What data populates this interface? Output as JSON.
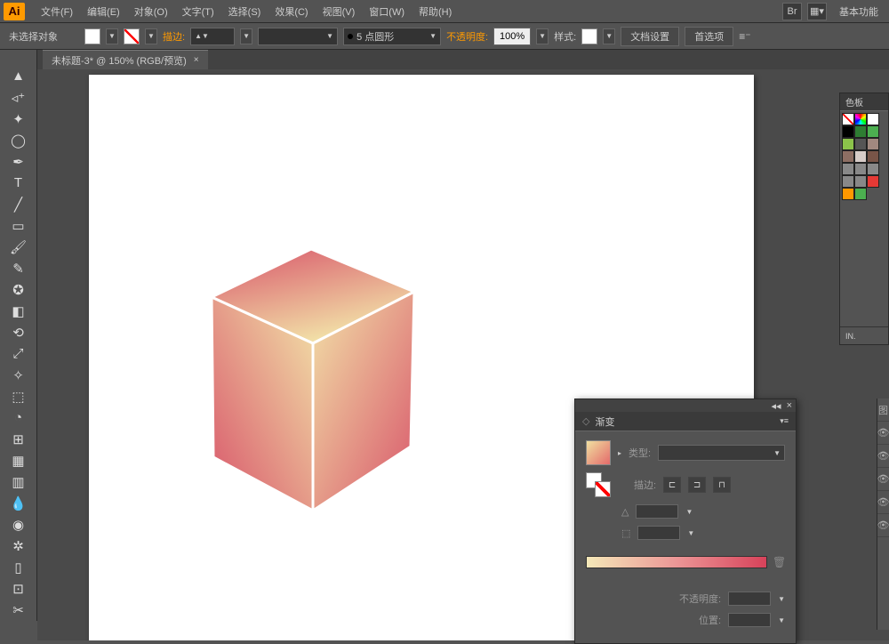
{
  "app": {
    "logo": "Ai"
  },
  "menu": {
    "file": "文件(F)",
    "edit": "编辑(E)",
    "object": "对象(O)",
    "type": "文字(T)",
    "select": "选择(S)",
    "effect": "效果(C)",
    "view": "视图(V)",
    "window": "窗口(W)",
    "help": "帮助(H)"
  },
  "workspace": "基本功能",
  "controlbar": {
    "selection": "未选择对象",
    "stroke_label": "描边:",
    "stroke_weight": "",
    "brush_preset": "5 点圆形",
    "opacity_label": "不透明度:",
    "opacity_value": "100%",
    "style_label": "样式:",
    "doc_setup": "文档设置",
    "preferences": "首选项"
  },
  "doc_tab": {
    "title": "未标题-3* @ 150% (RGB/预览)"
  },
  "swatches": {
    "title": "色板",
    "footer": "IN."
  },
  "gradient": {
    "title": "渐变",
    "type_label": "类型:",
    "stroke_label": "描边:",
    "angle_icon": "△",
    "aspect_icon": "⬚",
    "opacity_label": "不透明度:",
    "location_label": "位置:"
  },
  "layers_edge_title": "图"
}
